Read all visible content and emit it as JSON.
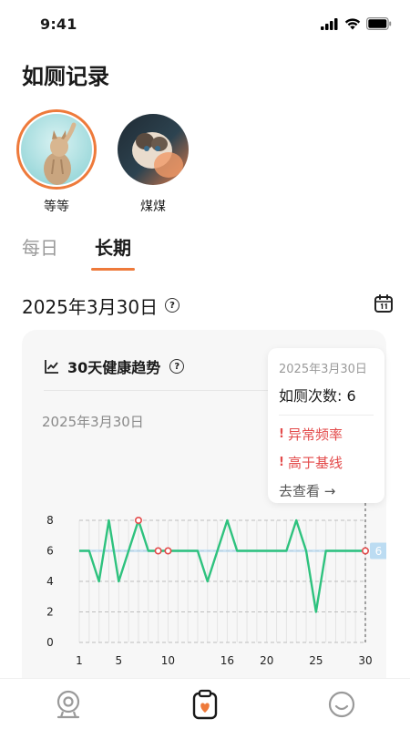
{
  "status_bar": {
    "time": "9:41"
  },
  "page": {
    "title": "如厕记录"
  },
  "pets": [
    {
      "name": "等等",
      "selected": true
    },
    {
      "name": "煤煤",
      "selected": false
    }
  ],
  "tabs": [
    {
      "label": "每日",
      "active": false
    },
    {
      "label": "长期",
      "active": true
    }
  ],
  "date_selector": {
    "date": "2025年3月30日"
  },
  "trend_card": {
    "title": "30天健康趋势",
    "date": "2025年3月30日"
  },
  "tooltip": {
    "date": "2025年3月30日",
    "count_label": "如厕次数: 6",
    "alerts": [
      "异常频率",
      "高于基线"
    ],
    "link": "去查看 →"
  },
  "colors": {
    "accent": "#ee7a3b",
    "line": "#2ec27e",
    "alert": "#e34b4b",
    "baseline_badge": "#bcdcf2"
  },
  "chart_data": {
    "type": "line",
    "x": [
      1,
      2,
      3,
      4,
      5,
      6,
      7,
      8,
      9,
      10,
      11,
      12,
      13,
      14,
      15,
      16,
      17,
      18,
      19,
      20,
      21,
      22,
      23,
      24,
      25,
      26,
      27,
      28,
      29,
      30
    ],
    "values": [
      6,
      6,
      4,
      8,
      4,
      6,
      8,
      6,
      6,
      6,
      6,
      6,
      6,
      4,
      6,
      8,
      6,
      6,
      6,
      6,
      6,
      6,
      8,
      6,
      2,
      6,
      6,
      6,
      6,
      6
    ],
    "highlight_days": [
      7,
      9,
      10,
      30
    ],
    "baseline": 6,
    "baseline_label": "6",
    "xticks": [
      1,
      5,
      10,
      16,
      20,
      25,
      30
    ],
    "yticks": [
      0,
      2,
      4,
      6,
      8
    ],
    "ylim": [
      0,
      8
    ],
    "xlim": [
      1,
      30
    ],
    "grid": true
  },
  "bottom_nav": [
    {
      "icon": "camera-icon",
      "active": false
    },
    {
      "icon": "clipboard-heart-icon",
      "active": true
    },
    {
      "icon": "smiley-icon",
      "active": false
    }
  ]
}
